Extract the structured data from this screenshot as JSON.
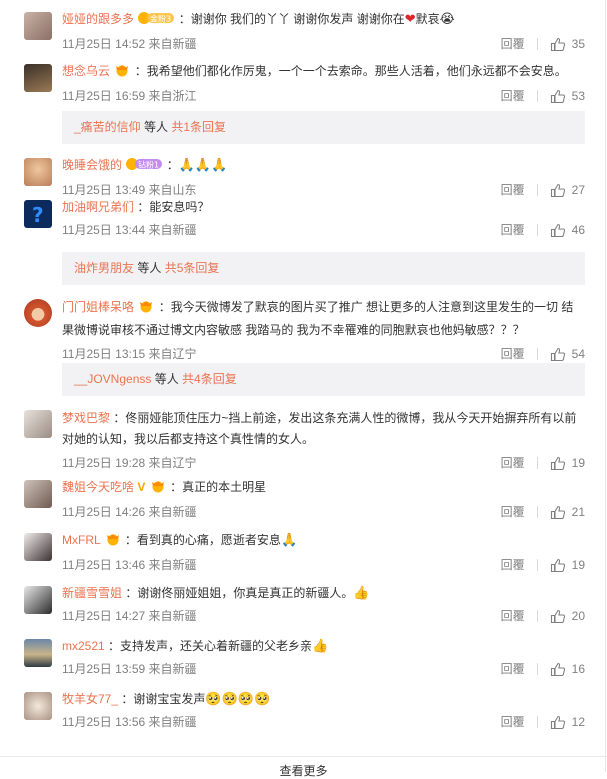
{
  "comments": [
    {
      "user": "娅娅的跟多多",
      "text": "：谢谢你 我们的丫丫 谢谢你发声 谢谢你在",
      "text2": "默哀",
      "time": "11月25日 14:52 来自新疆",
      "reply": "回覆",
      "likes": "35",
      "badge": "金粉3"
    },
    {
      "user": "想念乌云",
      "text": "：我希望他们都化作厉鬼，一个一个去索命。那些人活着，他们永远都不会安息。",
      "time": "11月25日 16:59 来自浙江",
      "reply": "回覆",
      "likes": "53"
    },
    {
      "user": "晚睡会饿的",
      "text": "：",
      "time": "11月25日 13:49 来自山东",
      "reply": "回覆",
      "likes": "27",
      "badge": "钻粉1"
    },
    {
      "user": "加油啊兄弟们",
      "text": "：能安息吗？",
      "time": "11月25日 13:44 来自新疆",
      "reply": "回覆",
      "likes": "46"
    },
    {
      "user": "门门姐棒呆咯",
      "text": "：我今天微博发了默哀的图片买了推广 想让更多的人注意到这里发生的一切 结果微博说审核不通过博文内容敏感 我踏马的 我为不幸罹难的同胞默哀也他妈敏感？？？",
      "time": "11月25日 13:15 来自辽宁",
      "reply": "回覆",
      "likes": "54"
    },
    {
      "user": "梦戏巴黎",
      "text": "：佟丽娅能顶住压力~挡上前途，发出这条充满人性的微博，我从今天开始摒弃所有以前对她的认知，我以后都支持这个真性情的女人。",
      "time": "11月25日 19:28 来自辽宁",
      "reply": "回覆",
      "likes": "19"
    },
    {
      "user": "魏姐今天吃啥",
      "text": "：真正的本土明星",
      "time": "11月25日 14:26 来自新疆",
      "reply": "回覆",
      "likes": "21"
    },
    {
      "user": "MxFRL",
      "text": "：看到真的心痛，愿逝者安息",
      "time": "11月25日 13:46 来自新疆",
      "reply": "回覆",
      "likes": "19"
    },
    {
      "user": "新疆雪雪姐",
      "text": "：谢谢佟丽娅姐姐，你真是真正的新疆人。",
      "time": "11月25日 14:27 来自新疆",
      "reply": "回覆",
      "likes": "20"
    },
    {
      "user": "mx2521",
      "text": "：支持发声，还关心着新疆的父老乡亲",
      "time": "11月25日 13:59 来自新疆",
      "reply": "回覆",
      "likes": "16"
    },
    {
      "user": "牧羊女77_",
      "text": "：谢谢宝宝发声",
      "time": "11月25日 13:56 来自新疆",
      "reply": "回覆",
      "likes": "12"
    }
  ],
  "reply_threads": [
    {
      "user": "_痛苦的信仰",
      "mid": " 等人 ",
      "count": "共1条回复"
    },
    {
      "user": "油炸男朋友",
      "mid": " 等人 ",
      "count": "共5条回复"
    },
    {
      "user": "__JOVNgenss",
      "mid": " 等人 ",
      "count": "共4条回复"
    }
  ],
  "footer": {
    "more": "查看更多"
  },
  "colors": {
    "username": "#eb7350",
    "meta": "#808080",
    "reply_bg": "#f2f2f5"
  }
}
